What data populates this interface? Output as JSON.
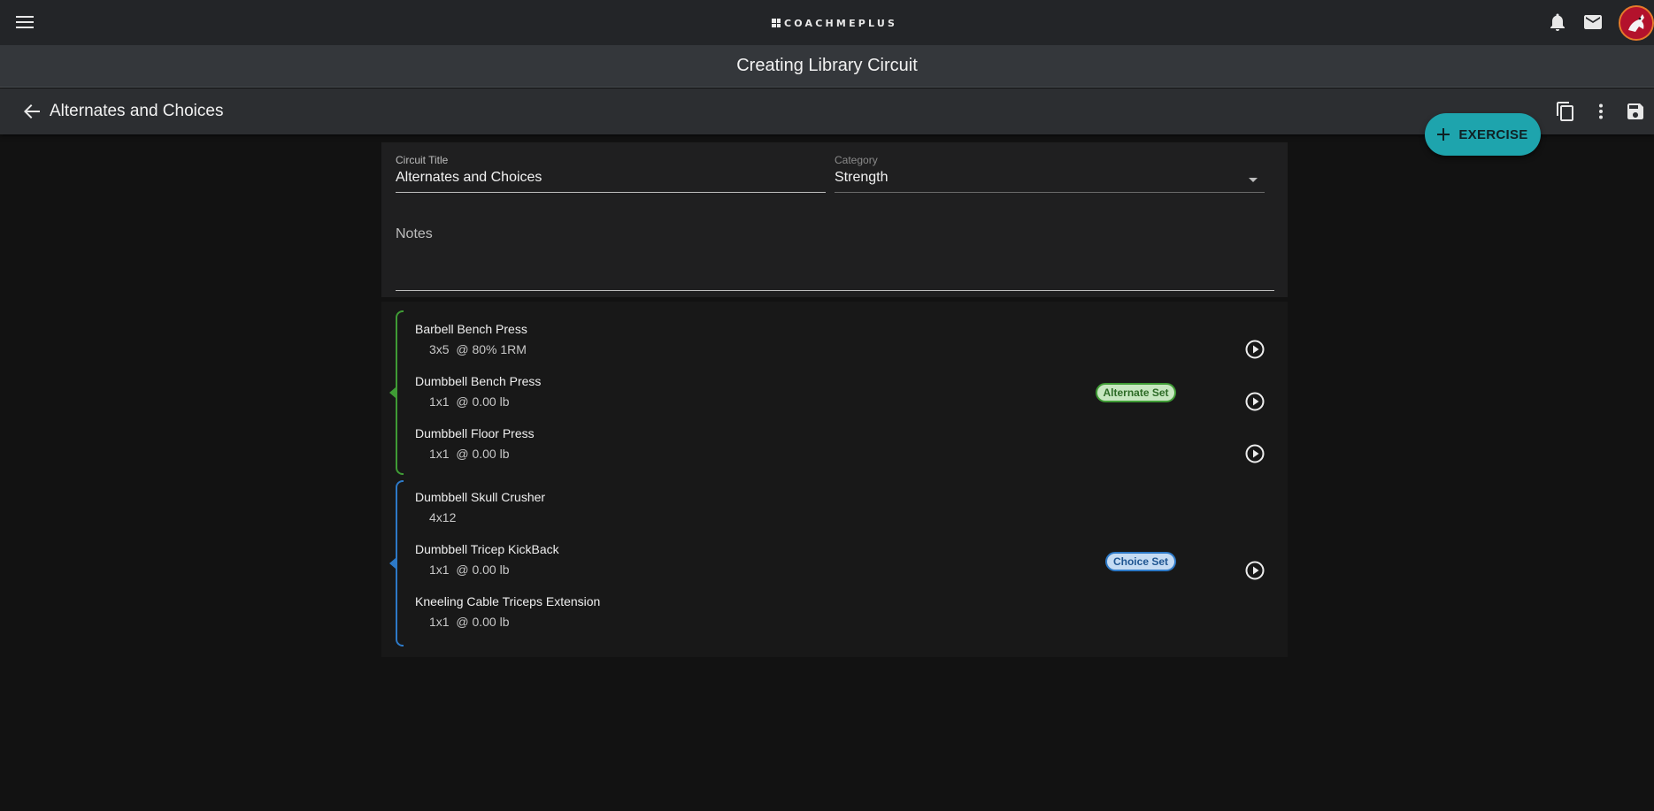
{
  "header": {
    "logo_text": "COACHMEPLUS"
  },
  "title_bar": {
    "title": "Creating Library Circuit"
  },
  "sub_bar": {
    "title": "Alternates and Choices"
  },
  "fab": {
    "label": "EXERCISE"
  },
  "form": {
    "circuit_title_label": "Circuit Title",
    "circuit_title_value": "Alternates and Choices",
    "category_label": "Category",
    "category_value": "Strength",
    "notes_label": "Notes"
  },
  "groups": [
    {
      "type": "alternate",
      "badge": "Alternate Set",
      "accent": "#3f9b35",
      "exercises": [
        {
          "name": "Barbell Bench Press",
          "prescription": "3x5  @ 80% 1RM"
        },
        {
          "name": "Dumbbell Bench Press",
          "prescription": "1x1  @ 0.00 lb"
        },
        {
          "name": "Dumbbell Floor Press",
          "prescription": "1x1  @ 0.00 lb"
        }
      ]
    },
    {
      "type": "choice",
      "badge": "Choice Set",
      "accent": "#2d79c7",
      "exercises": [
        {
          "name": "Dumbbell Skull Crusher",
          "prescription": "4x12"
        },
        {
          "name": "Dumbbell Tricep KickBack",
          "prescription": "1x1  @ 0.00 lb"
        },
        {
          "name": "Kneeling Cable Triceps Extension",
          "prescription": "1x1  @ 0.00 lb"
        }
      ]
    }
  ],
  "colors": {
    "fab": "#1ea4ad",
    "alternate": "#3f9b35",
    "choice": "#2d79c7"
  }
}
